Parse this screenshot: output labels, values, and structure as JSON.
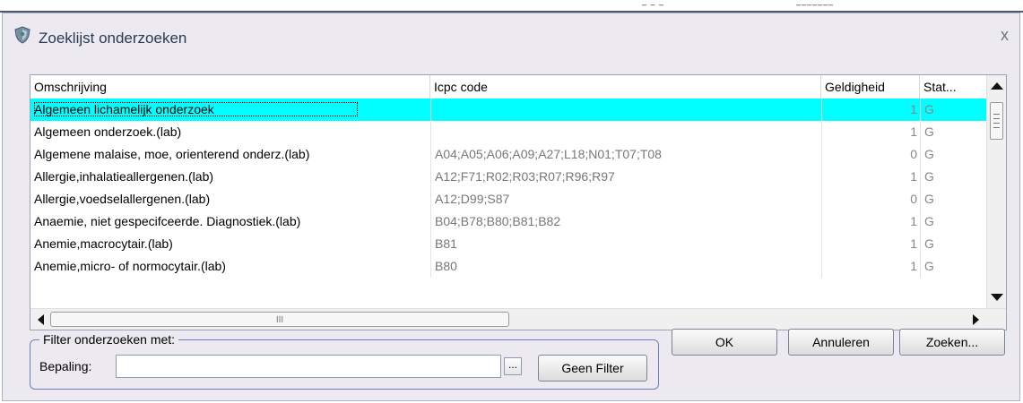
{
  "window": {
    "title": "Zoeklijst onderzoeken",
    "icon": "shield-icon",
    "close_label": "x"
  },
  "background_fragments": [
    "– – –",
    "–––––––"
  ],
  "grid": {
    "columns": [
      "Omschrijving",
      "Icpc code",
      "Geldigheid",
      "Stat..."
    ],
    "rows": [
      {
        "omschrijving": "Algemeen lichamelijk onderzoek",
        "icpc": "",
        "geldigheid": "1",
        "status": "G",
        "selected": true
      },
      {
        "omschrijving": "Algemeen onderzoek.(lab)",
        "icpc": "",
        "geldigheid": "1",
        "status": "G"
      },
      {
        "omschrijving": "Algemene malaise, moe, orienterend onderz.(lab)",
        "icpc": "A04;A05;A06;A09;A27;L18;N01;T07;T08",
        "geldigheid": "0",
        "status": "G"
      },
      {
        "omschrijving": "Allergie,inhalatieallergenen.(lab)",
        "icpc": "A12;F71;R02;R03;R07;R96;R97",
        "geldigheid": "1",
        "status": "G"
      },
      {
        "omschrijving": "Allergie,voedselallergenen.(lab)",
        "icpc": "A12;D99;S87",
        "geldigheid": "0",
        "status": "G"
      },
      {
        "omschrijving": "Anaemie, niet gespecifceerde. Diagnostiek.(lab)",
        "icpc": "B04;B78;B80;B81;B82",
        "geldigheid": "1",
        "status": "G"
      },
      {
        "omschrijving": "Anemie,macrocytair.(lab)",
        "icpc": "B81",
        "geldigheid": "1",
        "status": "G"
      },
      {
        "omschrijving": "Anemie,micro- of normocytair.(lab)",
        "icpc": "B80",
        "geldigheid": "1",
        "status": "G"
      }
    ],
    "selected_color": "#00ffff",
    "scroll_grip": "III"
  },
  "filter": {
    "legend": "Filter onderzoeken met:",
    "label": "Bepaling:",
    "value": "",
    "browse_label": "...",
    "clear_label": "Geen Filter"
  },
  "buttons": {
    "ok": "OK",
    "cancel": "Annuleren",
    "search": "Zoeken..."
  }
}
